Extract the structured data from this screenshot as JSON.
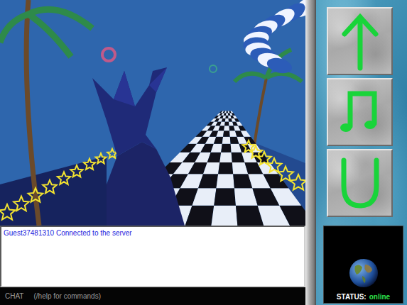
{
  "chat": {
    "messages": [
      {
        "text": "Guest37481310 Connected to the server"
      }
    ],
    "label": "CHAT",
    "hint": "(/help for commands)"
  },
  "actions": [
    {
      "kind": "arrow"
    },
    {
      "kind": "music"
    },
    {
      "kind": "smile"
    }
  ],
  "status": {
    "label": "STATUS:",
    "value": "online"
  }
}
